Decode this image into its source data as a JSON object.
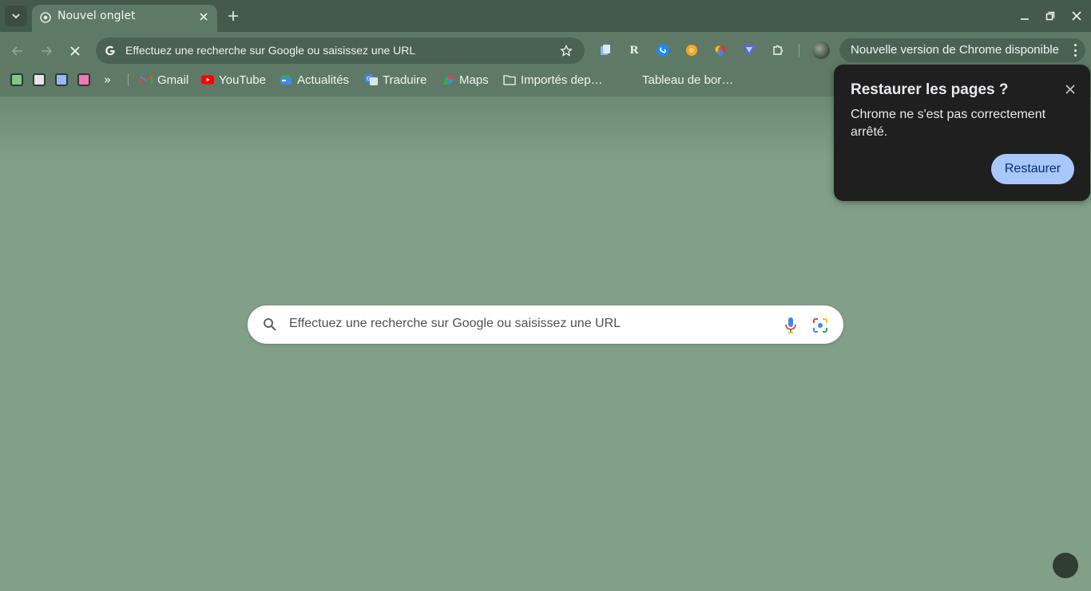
{
  "tab": {
    "title": "Nouvel onglet"
  },
  "omnibox": {
    "text": "Effectuez une recherche sur Google ou saisissez une URL"
  },
  "update": {
    "label": "Nouvelle version de Chrome disponible"
  },
  "bookmarks": {
    "more": "»",
    "items": [
      {
        "label": "Gmail",
        "icon": "gmail-icon"
      },
      {
        "label": "YouTube",
        "icon": "youtube-icon"
      },
      {
        "label": "Actualités",
        "icon": "news-icon"
      },
      {
        "label": "Traduire",
        "icon": "translate-icon"
      },
      {
        "label": "Maps",
        "icon": "maps-icon"
      },
      {
        "label": "Importés dep…",
        "icon": "folder-icon"
      },
      {
        "label": "Tableau de bor…",
        "icon": "none"
      }
    ],
    "app_colors": [
      "#7bc98a",
      "#e8e4ec",
      "#9bb6f2",
      "#f07ab4"
    ]
  },
  "search": {
    "placeholder": "Effectuez une recherche sur Google ou saisissez une URL"
  },
  "popup": {
    "title": "Restaurer les pages ?",
    "body": "Chrome ne s'est pas correctement arrêté.",
    "button": "Restaurer"
  },
  "colors": {
    "page_bg": "#829f88",
    "toolbar_bg": "#5e7a66",
    "popup_bg": "#1f1f1f",
    "accent_button": "#a8c7fa"
  }
}
